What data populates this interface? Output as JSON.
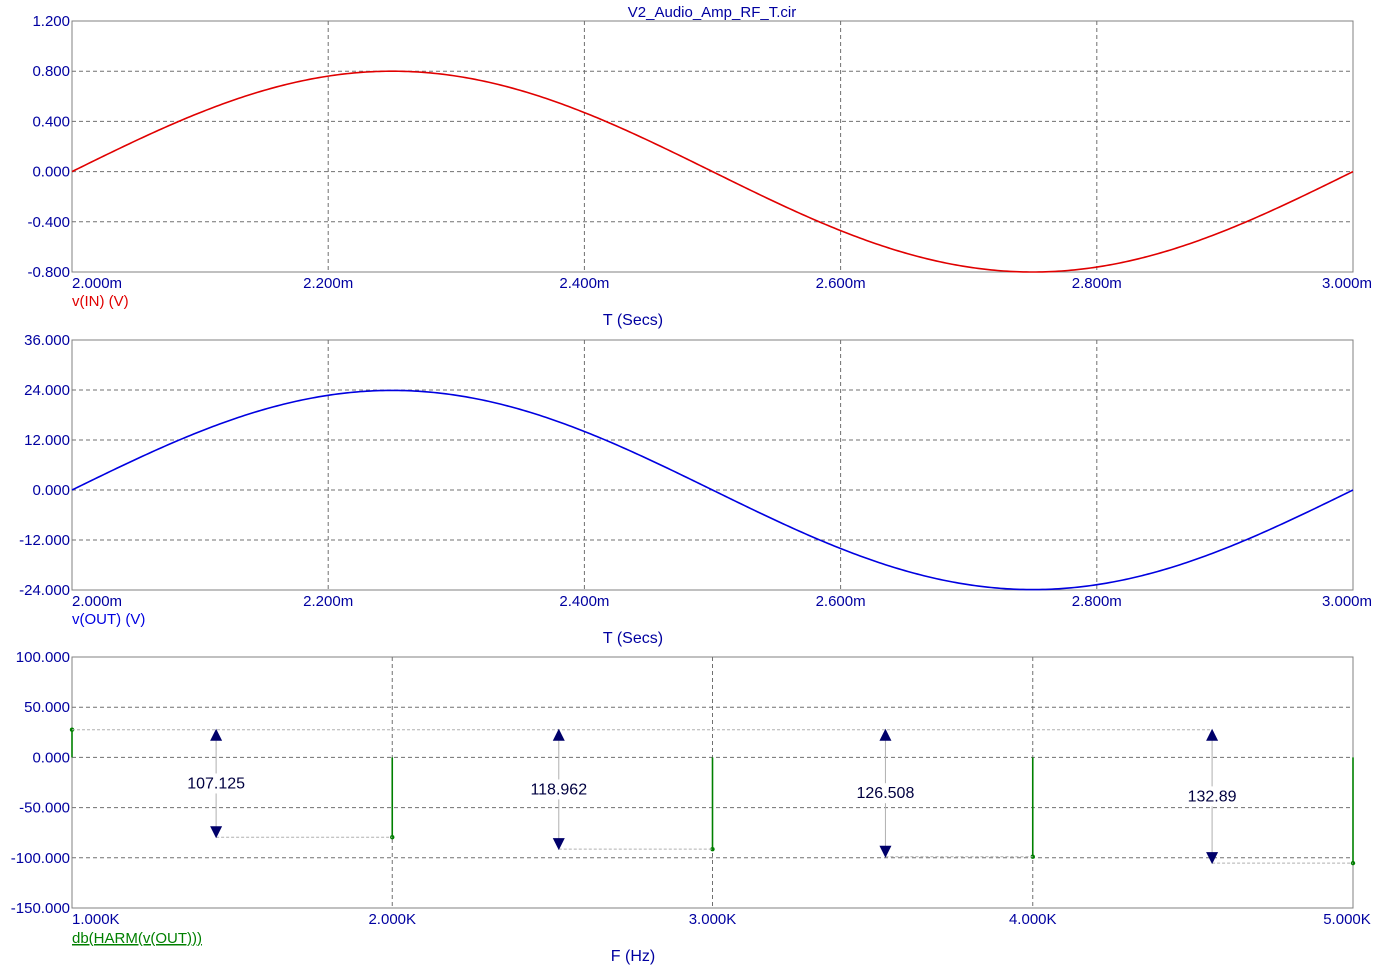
{
  "title": "V2_Audio_Amp_RF_T.cir",
  "colors": {
    "axis_text": "#0000a0",
    "grid": "#707070",
    "frame": "#808080",
    "in_trace": "#e00000",
    "out_trace": "#0000e0",
    "harm_trace": "#008000",
    "dim_line": "#b0b0b0",
    "dim_arrow": "#00006a"
  },
  "chart_data": [
    {
      "type": "line",
      "xlabel": "T (Secs)",
      "ylabel": "",
      "series": [
        {
          "name": "v(IN) (V)",
          "function": "sine",
          "amplitude": 0.8,
          "frequency_hz": 1000,
          "x_start": 0.002,
          "x_end": 0.003
        }
      ],
      "xlim": [
        0.002,
        0.003
      ],
      "ylim": [
        -0.8,
        1.2
      ],
      "x_ticks": [
        0.002,
        0.0022,
        0.0024,
        0.0026,
        0.0028,
        0.003
      ],
      "x_tick_labels": [
        "2.000m",
        "2.200m",
        "2.400m",
        "2.600m",
        "2.800m",
        "3.000m"
      ],
      "y_ticks": [
        -0.8,
        -0.4,
        0,
        0.4,
        0.8,
        1.2
      ],
      "y_tick_labels": [
        "-0.800",
        "-0.400",
        "0.000",
        "0.400",
        "0.800",
        "1.200"
      ],
      "grid": true
    },
    {
      "type": "line",
      "xlabel": "T (Secs)",
      "ylabel": "",
      "series": [
        {
          "name": "v(OUT) (V)",
          "function": "sine",
          "amplitude": 23.9,
          "frequency_hz": 1000,
          "x_start": 0.002,
          "x_end": 0.003
        }
      ],
      "xlim": [
        0.002,
        0.003
      ],
      "ylim": [
        -24,
        36
      ],
      "x_ticks": [
        0.002,
        0.0022,
        0.0024,
        0.0026,
        0.0028,
        0.003
      ],
      "x_tick_labels": [
        "2.000m",
        "2.200m",
        "2.400m",
        "2.600m",
        "2.800m",
        "3.000m"
      ],
      "y_ticks": [
        -24,
        -12,
        0,
        12,
        24,
        36
      ],
      "y_tick_labels": [
        "-24.000",
        "-12.000",
        "0.000",
        "12.000",
        "24.000",
        "36.000"
      ],
      "grid": true
    },
    {
      "type": "bar",
      "xlabel": "F (Hz)",
      "ylabel": "",
      "series": [
        {
          "name": "db(HARM(v(OUT)))",
          "x": [
            1000,
            2000,
            3000,
            4000,
            5000
          ],
          "values": [
            27.6,
            -79.5,
            -91.4,
            -98.9,
            -105.3
          ]
        }
      ],
      "xlim": [
        1000,
        5000
      ],
      "ylim": [
        -150,
        100
      ],
      "x_ticks": [
        1000,
        2000,
        3000,
        4000,
        5000
      ],
      "x_tick_labels": [
        "1.000K",
        "2.000K",
        "3.000K",
        "4.000K",
        "5.000K"
      ],
      "y_ticks": [
        -150,
        -100,
        -50,
        0,
        50,
        100
      ],
      "y_tick_labels": [
        "-150.000",
        "-100.000",
        "-50.000",
        "0.000",
        "50.000",
        "100.000"
      ],
      "grid": true,
      "annotations": [
        {
          "label": "107.125",
          "x": 1450,
          "top": 27.6,
          "bottom": -79.5
        },
        {
          "label": "118.962",
          "x": 2520,
          "top": 27.6,
          "bottom": -91.4
        },
        {
          "label": "126.508",
          "x": 3540,
          "top": 27.6,
          "bottom": -98.9
        },
        {
          "label": "132.89",
          "x": 4560,
          "top": 27.6,
          "bottom": -105.3
        }
      ]
    }
  ]
}
